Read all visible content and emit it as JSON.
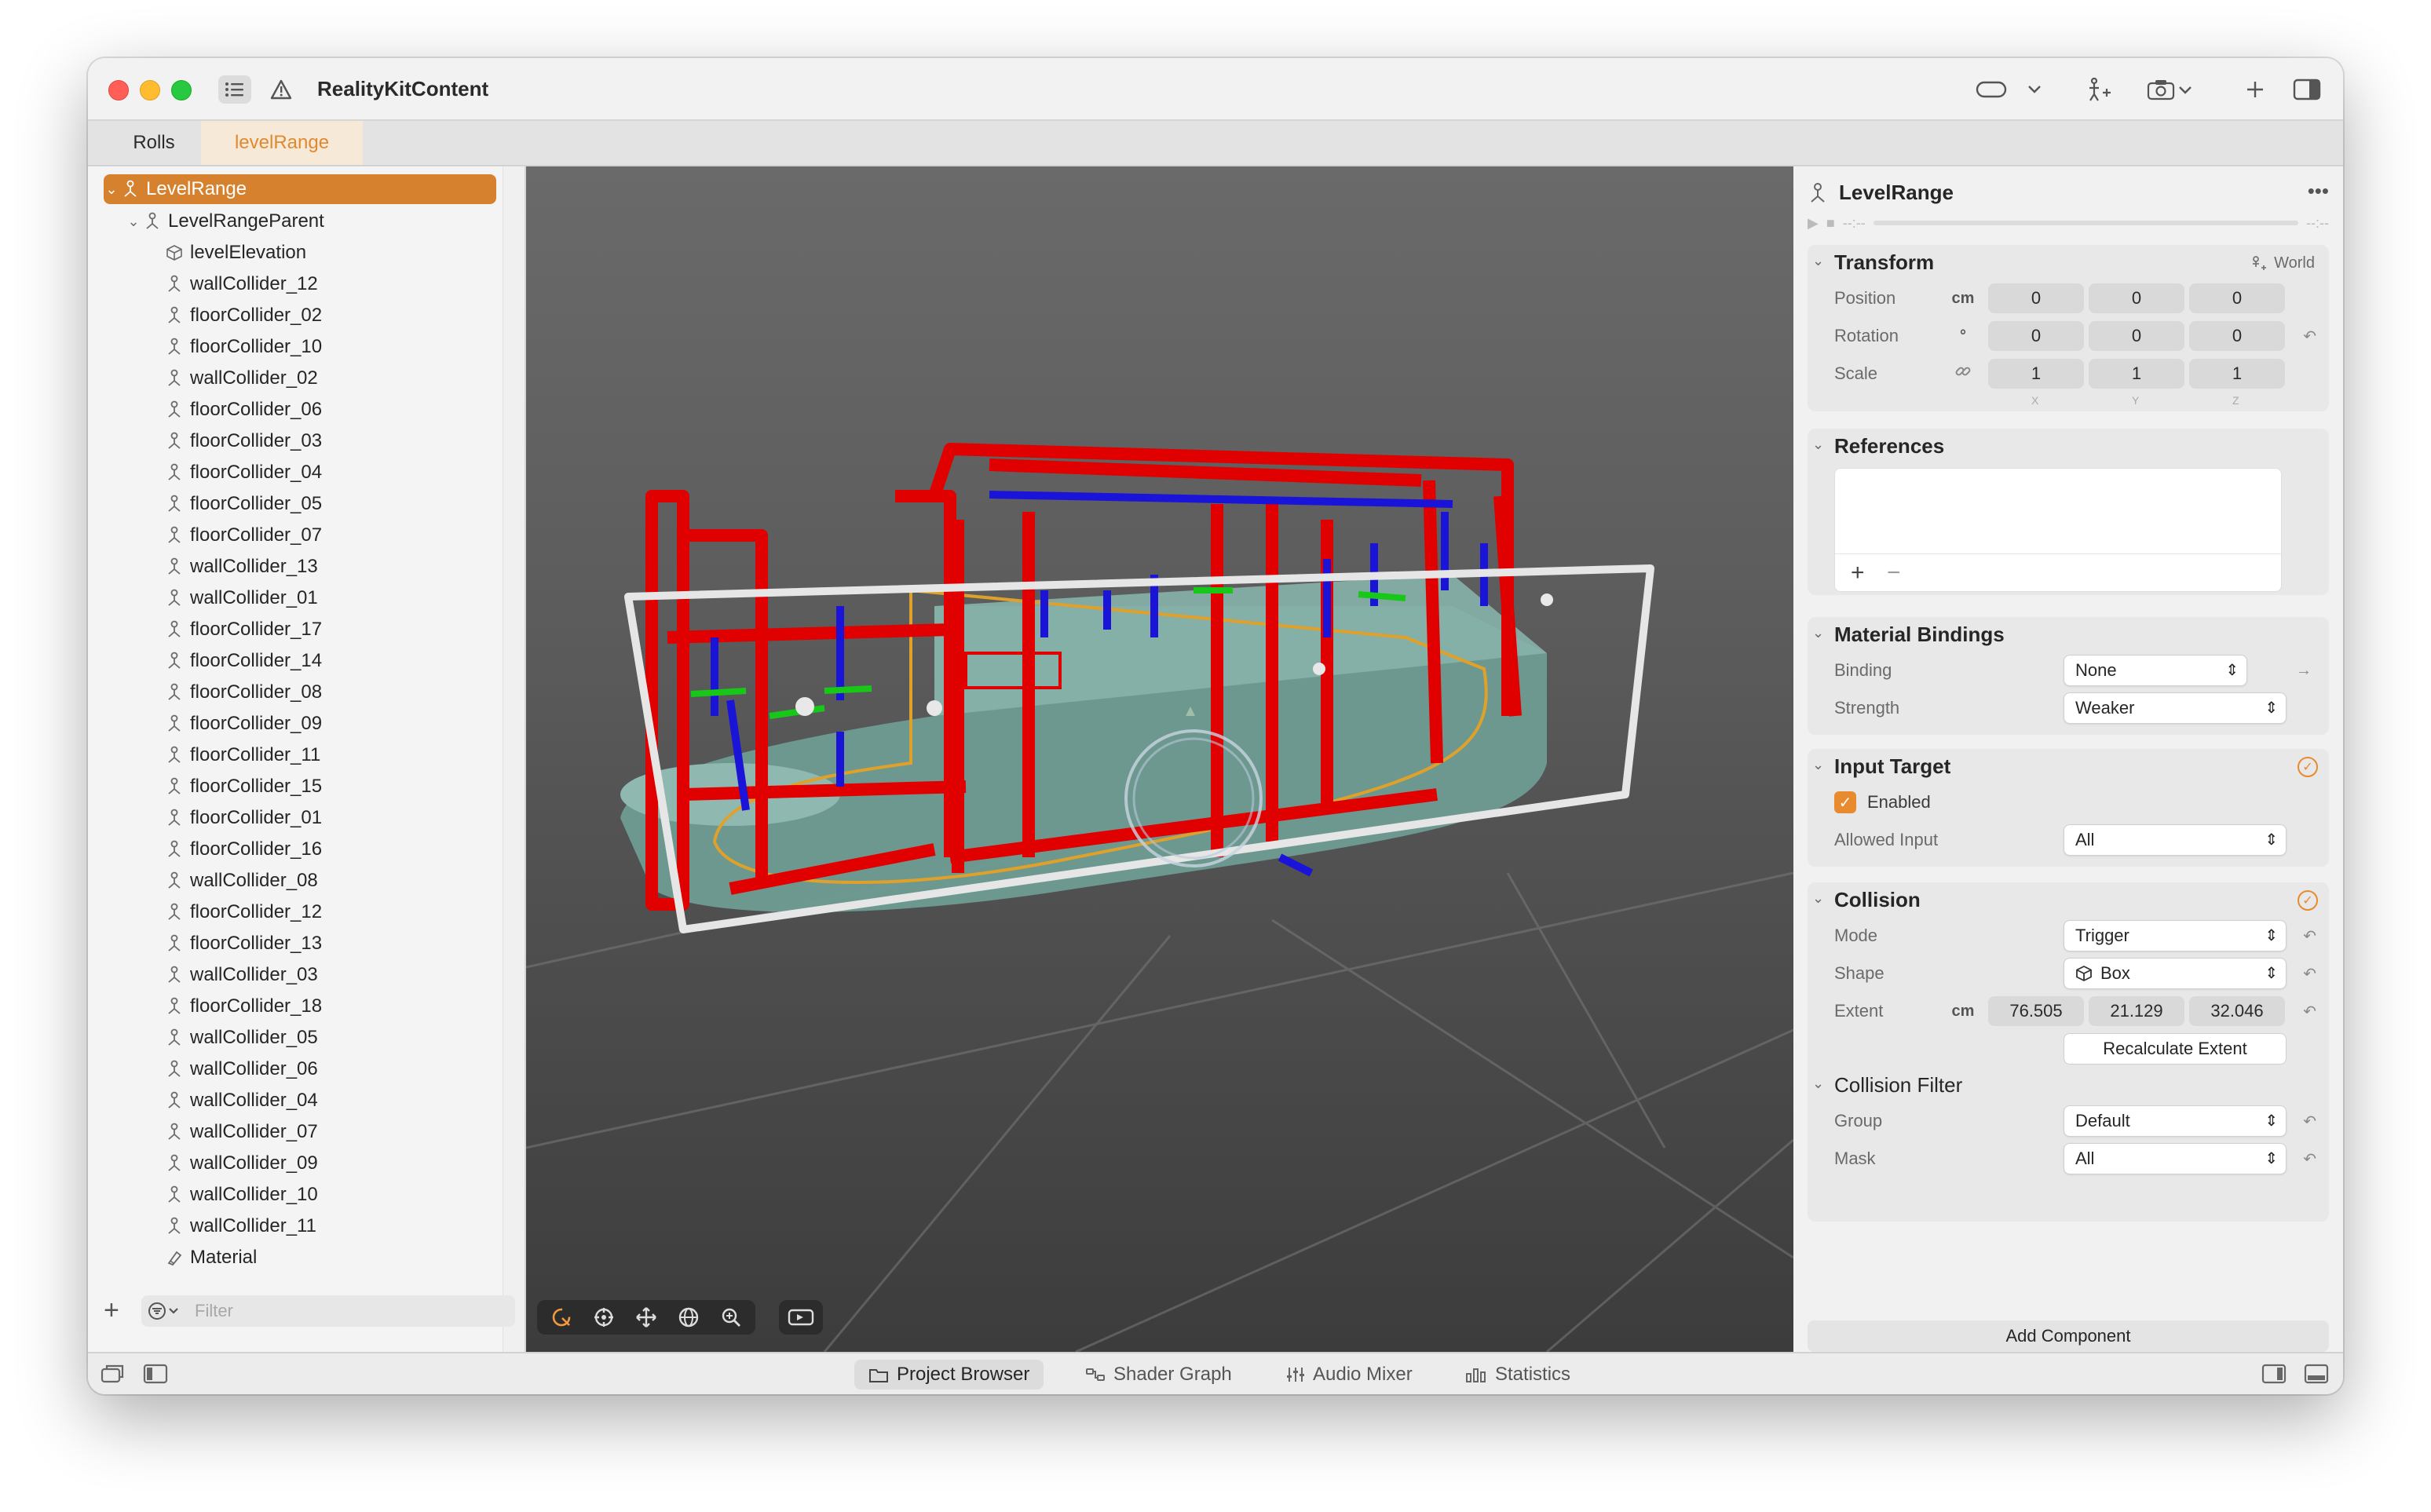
{
  "window": {
    "title": "RealityKitContent",
    "tabs": [
      {
        "label": "Rolls",
        "active": false
      },
      {
        "label": "levelRange",
        "active": true
      }
    ],
    "accent_color": "#d6812e"
  },
  "sidebar": {
    "tree": [
      {
        "label": "LevelRange",
        "level": 0,
        "icon": "entity-icon",
        "expanded": true,
        "selected": true
      },
      {
        "label": "LevelRangeParent",
        "level": 1,
        "icon": "entity-icon",
        "expanded": true
      },
      {
        "label": "levelElevation",
        "level": 2,
        "icon": "cube-icon"
      },
      {
        "label": "wallCollider_12",
        "level": 2,
        "icon": "entity-icon"
      },
      {
        "label": "floorCollider_02",
        "level": 2,
        "icon": "entity-icon"
      },
      {
        "label": "floorCollider_10",
        "level": 2,
        "icon": "entity-icon"
      },
      {
        "label": "wallCollider_02",
        "level": 2,
        "icon": "entity-icon"
      },
      {
        "label": "floorCollider_06",
        "level": 2,
        "icon": "entity-icon"
      },
      {
        "label": "floorCollider_03",
        "level": 2,
        "icon": "entity-icon"
      },
      {
        "label": "floorCollider_04",
        "level": 2,
        "icon": "entity-icon"
      },
      {
        "label": "floorCollider_05",
        "level": 2,
        "icon": "entity-icon"
      },
      {
        "label": "floorCollider_07",
        "level": 2,
        "icon": "entity-icon"
      },
      {
        "label": "wallCollider_13",
        "level": 2,
        "icon": "entity-icon"
      },
      {
        "label": "wallCollider_01",
        "level": 2,
        "icon": "entity-icon"
      },
      {
        "label": "floorCollider_17",
        "level": 2,
        "icon": "entity-icon"
      },
      {
        "label": "floorCollider_14",
        "level": 2,
        "icon": "entity-icon"
      },
      {
        "label": "floorCollider_08",
        "level": 2,
        "icon": "entity-icon"
      },
      {
        "label": "floorCollider_09",
        "level": 2,
        "icon": "entity-icon"
      },
      {
        "label": "floorCollider_11",
        "level": 2,
        "icon": "entity-icon"
      },
      {
        "label": "floorCollider_15",
        "level": 2,
        "icon": "entity-icon"
      },
      {
        "label": "floorCollider_01",
        "level": 2,
        "icon": "entity-icon"
      },
      {
        "label": "floorCollider_16",
        "level": 2,
        "icon": "entity-icon"
      },
      {
        "label": "wallCollider_08",
        "level": 2,
        "icon": "entity-icon"
      },
      {
        "label": "floorCollider_12",
        "level": 2,
        "icon": "entity-icon"
      },
      {
        "label": "floorCollider_13",
        "level": 2,
        "icon": "entity-icon"
      },
      {
        "label": "wallCollider_03",
        "level": 2,
        "icon": "entity-icon"
      },
      {
        "label": "floorCollider_18",
        "level": 2,
        "icon": "entity-icon"
      },
      {
        "label": "wallCollider_05",
        "level": 2,
        "icon": "entity-icon"
      },
      {
        "label": "wallCollider_06",
        "level": 2,
        "icon": "entity-icon"
      },
      {
        "label": "wallCollider_04",
        "level": 2,
        "icon": "entity-icon"
      },
      {
        "label": "wallCollider_07",
        "level": 2,
        "icon": "entity-icon"
      },
      {
        "label": "wallCollider_09",
        "level": 2,
        "icon": "entity-icon"
      },
      {
        "label": "wallCollider_10",
        "level": 2,
        "icon": "entity-icon"
      },
      {
        "label": "wallCollider_11",
        "level": 2,
        "icon": "entity-icon"
      },
      {
        "label": "Material",
        "level": 2,
        "icon": "material-icon"
      }
    ],
    "filter_placeholder": "Filter"
  },
  "inspector": {
    "entity_name": "LevelRange",
    "timeline_start": "--:--",
    "timeline_end": "--:--",
    "transform": {
      "title": "Transform",
      "space": "World",
      "position_label": "Position",
      "position_unit": "cm",
      "position": [
        "0",
        "0",
        "0"
      ],
      "rotation_label": "Rotation",
      "rotation_unit": "°",
      "rotation": [
        "0",
        "0",
        "0"
      ],
      "scale_label": "Scale",
      "scale": [
        "1",
        "1",
        "1"
      ],
      "axes": [
        "X",
        "Y",
        "Z"
      ]
    },
    "references": {
      "title": "References"
    },
    "material_bindings": {
      "title": "Material Bindings",
      "binding_label": "Binding",
      "binding_value": "None",
      "strength_label": "Strength",
      "strength_value": "Weaker"
    },
    "input_target": {
      "title": "Input Target",
      "enabled_label": "Enabled",
      "enabled": true,
      "allowed_input_label": "Allowed Input",
      "allowed_input_value": "All"
    },
    "collision": {
      "title": "Collision",
      "mode_label": "Mode",
      "mode_value": "Trigger",
      "shape_label": "Shape",
      "shape_value": "Box",
      "extent_label": "Extent",
      "extent_unit": "cm",
      "extent": [
        "76.505",
        "21.129",
        "32.046"
      ],
      "recalculate_label": "Recalculate Extent"
    },
    "collision_filter": {
      "title": "Collision Filter",
      "group_label": "Group",
      "group_value": "Default",
      "mask_label": "Mask",
      "mask_value": "All"
    },
    "add_component_label": "Add Component"
  },
  "bottom_tabs": [
    {
      "label": "Project Browser",
      "icon": "folder-icon",
      "active": true
    },
    {
      "label": "Shader Graph",
      "icon": "nodes-icon",
      "active": false
    },
    {
      "label": "Audio Mixer",
      "icon": "sliders-icon",
      "active": false
    },
    {
      "label": "Statistics",
      "icon": "chart-icon",
      "active": false
    }
  ]
}
